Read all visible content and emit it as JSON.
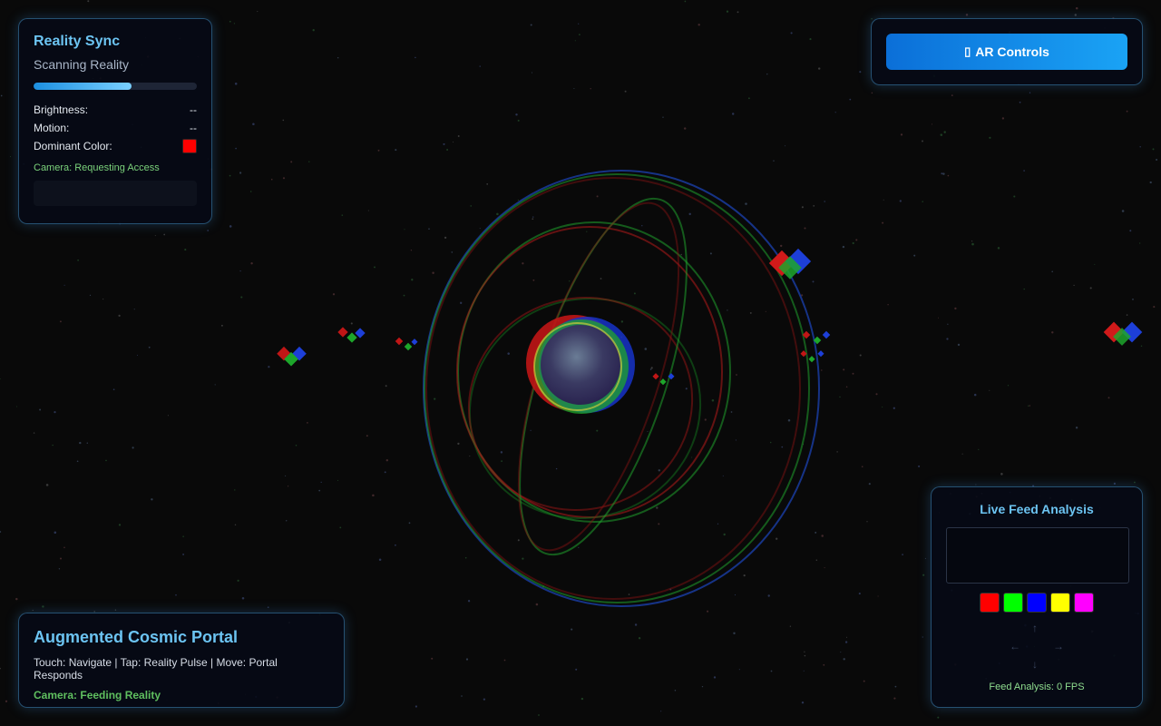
{
  "sync": {
    "title": "Reality Sync",
    "status": "Scanning Reality",
    "progress": 0.6,
    "brightness_label": "Brightness:",
    "brightness_value": "--",
    "motion_label": "Motion:",
    "motion_value": "--",
    "dominant_label": "Dominant Color:",
    "dominant_color": "#ff0000",
    "camera_status": "Camera: Requesting Access"
  },
  "controls": {
    "icon": "gamepad-icon",
    "label": "AR Controls"
  },
  "info": {
    "title": "Augmented Cosmic Portal",
    "help": "Touch: Navigate | Tap: Reality Pulse | Move: Portal Responds",
    "camera": "Camera: Feeding Reality"
  },
  "feed": {
    "title": "Live Feed Analysis",
    "palette": [
      "#ff0000",
      "#00ff00",
      "#0000ff",
      "#ffff00",
      "#ff00ff"
    ],
    "arrows": {
      "up": "↑",
      "left": "←",
      "right": "→",
      "down": "↓"
    },
    "fps": "Feed Analysis: 0 FPS"
  },
  "colors": {
    "accent": "#6cc4f2",
    "button": "#0b6fd8",
    "success": "#7bd27b"
  }
}
